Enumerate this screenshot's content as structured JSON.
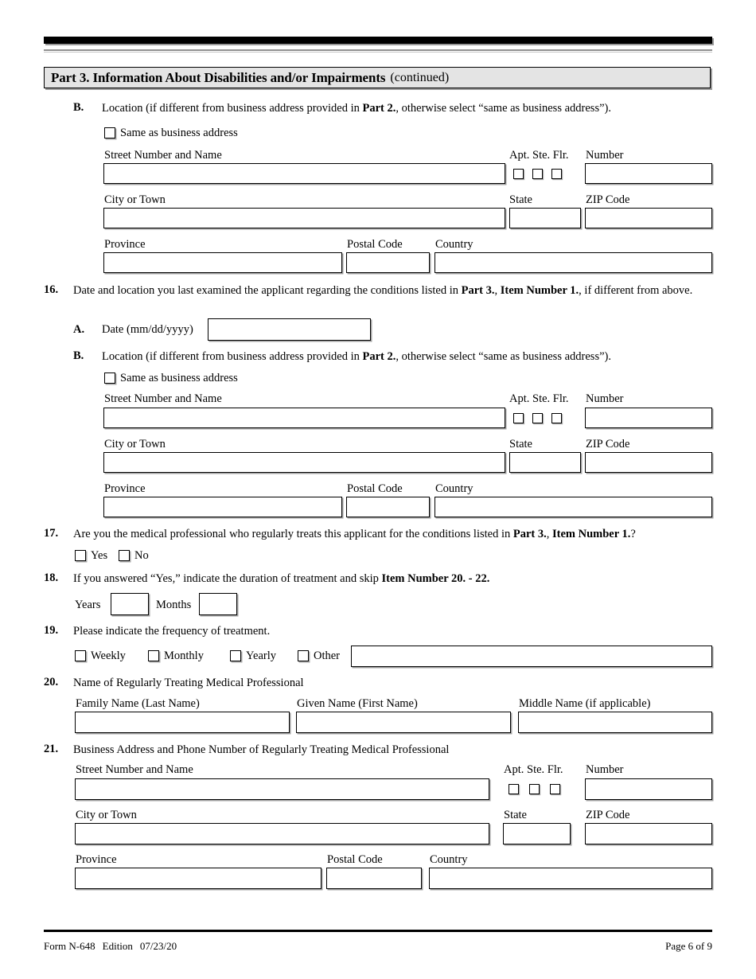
{
  "header": {
    "part_bold": "Part 3.  Information About Disabilities and/or Impairments",
    "part_continued": "(continued)"
  },
  "items": {
    "item15b": {
      "letter": "B.",
      "text_a": "Location (if different from business address provided in ",
      "text_b": "Part 2.",
      "text_c": ", otherwise select “same as business address”).",
      "same_as_label": "Same as business address"
    },
    "item16": {
      "number": "16.",
      "text_a": "Date and location you last examined the applicant regarding the conditions listed in ",
      "text_b": "Part 3.",
      "text_c": ", ",
      "text_d": "Item Number 1.",
      "text_e": ", if different from above.",
      "sub_a": {
        "letter": "A.",
        "label": "Date (mm/dd/yyyy)",
        "value": ""
      },
      "sub_b": {
        "letter": "B.",
        "text_a": "Location (if different from business address provided in ",
        "text_b": "Part 2.",
        "text_c": ", otherwise select “same as business address”).",
        "same_as_label": "Same as business address"
      }
    },
    "item17": {
      "number": "17.",
      "text_a": "Are you the medical professional who regularly treats this applicant for the conditions listed in ",
      "text_b": "Part 3.",
      "text_c": ", ",
      "text_d": "Item Number 1.",
      "text_e": "?",
      "yes_label": "Yes",
      "no_label": "No"
    },
    "item18": {
      "number": "18.",
      "text_a": "If you answered “Yes,” indicate the duration of treatment and skip ",
      "text_b": "Item Number 20. - 22.",
      "years_label": "Years",
      "years_value": "",
      "months_label": "Months",
      "months_value": ""
    },
    "item19": {
      "number": "19.",
      "text": "Please indicate the frequency of treatment.",
      "options": [
        "Weekly",
        "Monthly",
        "Yearly",
        "Other"
      ],
      "other_value": ""
    },
    "item20": {
      "number": "20.",
      "text": "Name of Regularly Treating Medical Professional",
      "family_label": "Family Name (Last Name)",
      "family_value": "",
      "given_label": "Given Name (First Name)",
      "given_value": "",
      "middle_label": "Middle Name (if applicable)",
      "middle_value": ""
    },
    "item21": {
      "number": "21.",
      "text": "Business Address and Phone Number of Regularly Treating Medical Professional"
    }
  },
  "address_labels": {
    "street": "Street Number and Name",
    "apt": "Apt.",
    "ste": "Ste.",
    "flr": "Flr.",
    "number": "Number",
    "city": "City or Town",
    "state": "State",
    "zip": "ZIP Code",
    "province": "Province",
    "postal": "Postal Code",
    "country": "Country"
  },
  "address_values": {
    "street": "",
    "number": "",
    "city": "",
    "state": "",
    "zip": "",
    "province": "",
    "postal": "",
    "country": ""
  },
  "footer": {
    "form": "Form N-648",
    "edition_label": "Edition",
    "edition_date": "07/23/20",
    "page": "Page 6 of 9"
  }
}
